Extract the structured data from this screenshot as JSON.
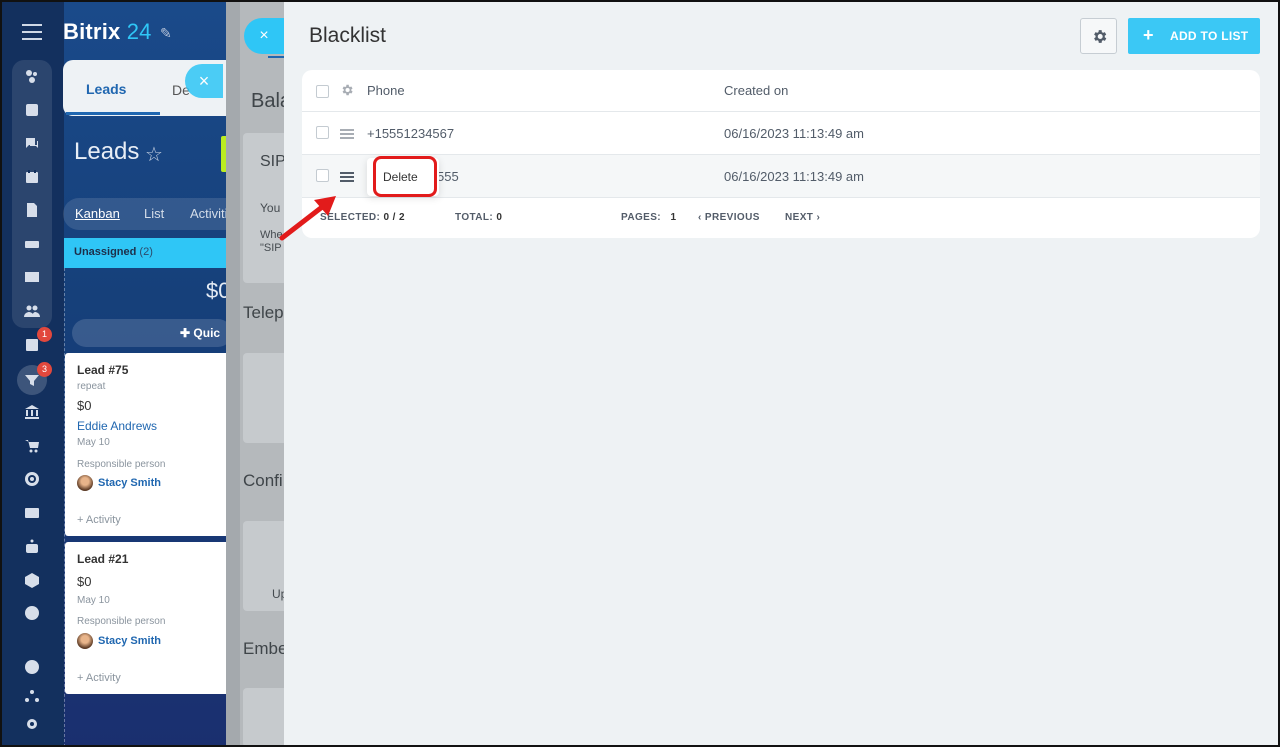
{
  "app": {
    "logo_name": "Bitrix",
    "logo_num": "24"
  },
  "rail": {
    "badges": {
      "tasks": "1",
      "crm": "3"
    }
  },
  "crm": {
    "tab_leads": "Leads",
    "tab_deals_partial": "De",
    "page_title": "Leads",
    "views": {
      "kanban": "Kanban",
      "list": "List",
      "activities_partial": "Activiti"
    },
    "column": {
      "title": "Unassigned",
      "count": "(2)",
      "sum_partial": "$0"
    },
    "quick_partial": "Quic",
    "cards": [
      {
        "title": "Lead #75",
        "subtitle": "repeat",
        "amount": "$0",
        "contact": "Eddie Andrews",
        "date": "May 10",
        "resp_label": "Responsible person",
        "person": "Stacy Smith",
        "activity": "+ Activity"
      },
      {
        "title": "Lead #21",
        "subtitle": "",
        "amount": "$0",
        "contact": "",
        "date": "May 10",
        "resp_label": "Responsible person",
        "person": "Stacy Smith",
        "activity": "+ Activity"
      }
    ]
  },
  "middle": {
    "bala": "Bala",
    "sip": "SIP",
    "you": "You",
    "whe": "Whe",
    "sip_quote": "\"SIP",
    "telep": "Telep",
    "confi": "Confi",
    "up": "Up",
    "embe": "Embe"
  },
  "blacklist": {
    "title": "Blacklist",
    "add_button": "ADD TO LIST",
    "columns": {
      "phone": "Phone",
      "created": "Created on"
    },
    "rows": [
      {
        "phone": "+15551234567",
        "created": "06/16/2023 11:13:49 am"
      },
      {
        "phone_visible": "555",
        "created": "06/16/2023 11:13:49 am"
      }
    ],
    "context_menu": {
      "delete": "Delete"
    },
    "footer": {
      "selected_label": "SELECTED:",
      "selected_value": "0 / 2",
      "total_label": "TOTAL:",
      "total_value": "0",
      "pages_label": "PAGES:",
      "pages_value": "1",
      "previous": "PREVIOUS",
      "next": "NEXT"
    }
  },
  "colors": {
    "accent": "#3bc8f5",
    "highlight": "#e21b1b",
    "link": "#2067b0"
  }
}
